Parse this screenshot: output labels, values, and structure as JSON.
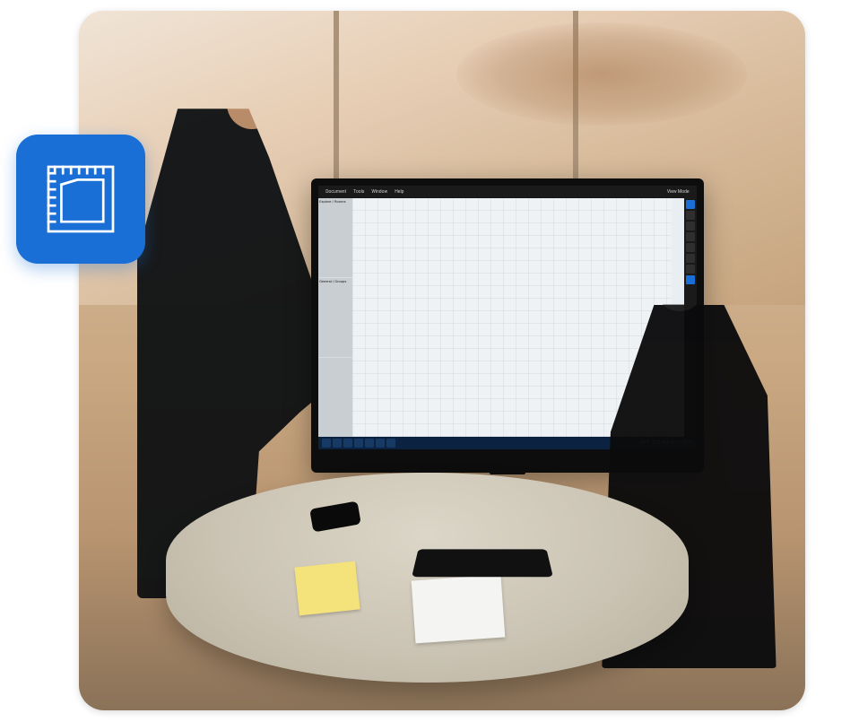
{
  "icon_badge": {
    "name": "blueprint-icon",
    "color": "#1a6fd6"
  },
  "monitor": {
    "menu": {
      "document": "Document",
      "tools": "Tools",
      "window": "Window",
      "help": "Help"
    },
    "view_mode": "View Mode",
    "panels": {
      "p1": "Explore / Rooms",
      "p2": "General / Groups"
    },
    "taskbar": {
      "time": "2:31 PM",
      "date": "9/11/2019",
      "temp": "68°F"
    }
  }
}
